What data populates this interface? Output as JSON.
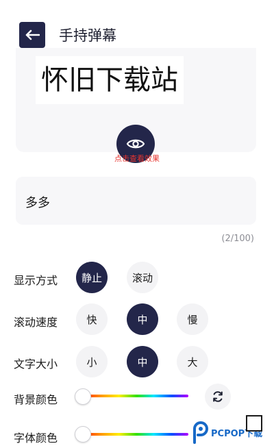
{
  "header": {
    "title": "手持弹幕",
    "back_icon": "arrow-left-icon"
  },
  "preview": {
    "text": "怀旧下载站",
    "hint": "点击查看效果",
    "eye_icon": "eye-icon"
  },
  "input": {
    "value": "多多",
    "char_count": "(2/100)"
  },
  "settings": {
    "display_mode": {
      "label": "显示方式",
      "options": [
        "静止",
        "滚动"
      ],
      "selected": "静止"
    },
    "scroll_speed": {
      "label": "滚动速度",
      "options": [
        "快",
        "中",
        "慢"
      ],
      "selected": "中"
    },
    "font_size": {
      "label": "文字大小",
      "options": [
        "小",
        "中",
        "大"
      ],
      "selected": "中"
    },
    "bg_color": {
      "label": "背景颜色",
      "slider_value": 0
    },
    "font_color": {
      "label": "字体颜色",
      "slider_value": 0
    }
  },
  "watermark": {
    "text": "PCPOP下载"
  },
  "colors": {
    "accent": "#23264a",
    "card_bg": "#f7f7f9",
    "hint_red": "#e6342f"
  }
}
